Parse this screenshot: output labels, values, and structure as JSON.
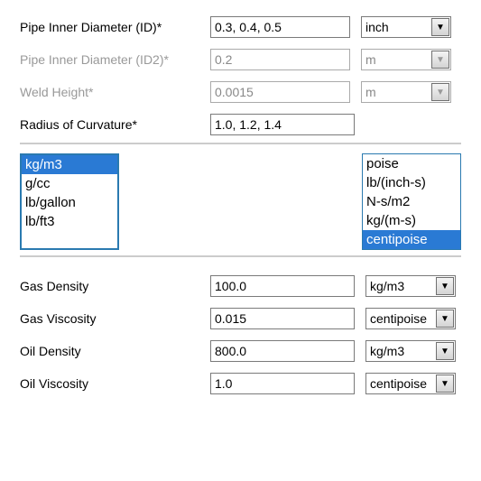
{
  "top": {
    "rows": [
      {
        "label": "Pipe Inner Diameter (ID)*",
        "value": "0.3, 0.4, 0.5",
        "unit": "inch",
        "enabled": true
      },
      {
        "label": "Pipe Inner Diameter (ID2)*",
        "value": "0.2",
        "unit": "m",
        "enabled": false
      },
      {
        "label": "Weld Height*",
        "value": "0.0015",
        "unit": "m",
        "enabled": false
      },
      {
        "label": "Radius of Curvature*",
        "value": "1.0, 1.2, 1.4",
        "unit": "",
        "enabled": true
      }
    ]
  },
  "density_units": {
    "items": [
      "kg/m3",
      "g/cc",
      "lb/gallon",
      "lb/ft3"
    ],
    "selected": "kg/m3"
  },
  "viscosity_units": {
    "items": [
      "poise",
      "lb/(inch-s)",
      "N-s/m2",
      "kg/(m-s)",
      "centipoise"
    ],
    "selected": "centipoise"
  },
  "bottom": {
    "rows": [
      {
        "label": "Gas Density",
        "value": "100.0",
        "unit": "kg/m3"
      },
      {
        "label": "Gas Viscosity",
        "value": "0.015",
        "unit": "centipoise"
      },
      {
        "label": "Oil Density",
        "value": "800.0",
        "unit": "kg/m3"
      },
      {
        "label": "Oil Viscosity",
        "value": "1.0",
        "unit": "centipoise"
      }
    ]
  }
}
